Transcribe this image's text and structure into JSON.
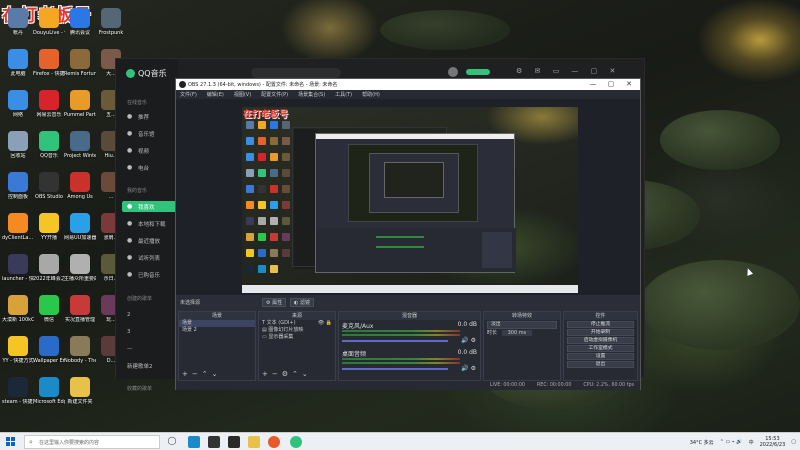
{
  "watermark": "在打老板号",
  "desktop_icons": [
    {
      "label": "帐丹",
      "icon": "notebook-icon",
      "color": "#5a7aa8"
    },
    {
      "label": "DouyuLive - 快捷方式",
      "icon": "douyu-icon",
      "color": "#f5a623"
    },
    {
      "label": "腾讯会议",
      "icon": "meeting-icon",
      "color": "#2b77e5"
    },
    {
      "label": "Frostpunk",
      "icon": "game-icon",
      "color": "#556677"
    },
    {
      "label": "此电脑",
      "icon": "computer-icon",
      "color": "#3a8ee6"
    },
    {
      "label": "Firefox - 快捷方式",
      "icon": "firefox-icon",
      "color": "#e5622b"
    },
    {
      "label": "Remis Fortune ...",
      "icon": "game-icon",
      "color": "#8a6a3a"
    },
    {
      "label": "大...",
      "icon": "game-icon",
      "color": "#7a5a4a"
    },
    {
      "label": "网络",
      "icon": "network-icon",
      "color": "#3a8ee6"
    },
    {
      "label": "网易云音乐",
      "icon": "music-icon",
      "color": "#d8232a"
    },
    {
      "label": "Pummel Party",
      "icon": "game-icon",
      "color": "#e89a2a"
    },
    {
      "label": "五...",
      "icon": "game-icon",
      "color": "#6a5a3a"
    },
    {
      "label": "回收站",
      "icon": "recycle-bin-icon",
      "color": "#8aa0b8"
    },
    {
      "label": "QQ音乐",
      "icon": "qqmusic-icon",
      "color": "#31c27c"
    },
    {
      "label": "Project Winter",
      "icon": "game-icon",
      "color": "#4a6a8a"
    },
    {
      "label": "Hiu...",
      "icon": "game-icon",
      "color": "#5a4a3a"
    },
    {
      "label": "控制面板",
      "icon": "control-panel-icon",
      "color": "#3a7ad6"
    },
    {
      "label": "OBS Studio",
      "icon": "obs-icon",
      "color": "#333333"
    },
    {
      "label": "Among Us",
      "icon": "amongus-icon",
      "color": "#c8322a"
    },
    {
      "label": "...",
      "icon": "game-icon",
      "color": "#6a4a3a"
    },
    {
      "label": "dyClientLa... - 快捷方式",
      "icon": "douyu-icon",
      "color": "#f58a23"
    },
    {
      "label": "YY开播",
      "icon": "yy-icon",
      "color": "#f5c623"
    },
    {
      "label": "网易UU加速器",
      "icon": "uu-icon",
      "color": "#2aa0e8"
    },
    {
      "label": "涨肩...",
      "icon": "game-icon",
      "color": "#7a3a3a"
    },
    {
      "label": "launcher - 快捷方式",
      "icon": "launcher-icon",
      "color": "#3a3a5a"
    },
    {
      "label": "2022年峰会之森的特质",
      "icon": "file-icon",
      "color": "#a8a8a8"
    },
    {
      "label": "主播众所重要的图",
      "icon": "file-icon",
      "color": "#b0b0b0"
    },
    {
      "label": "示日...",
      "icon": "game-icon",
      "color": "#5a5a3a"
    },
    {
      "label": "大漠新 100kChe...",
      "icon": "app-icon",
      "color": "#d8a23a"
    },
    {
      "label": "微信",
      "icon": "wechat-icon",
      "color": "#2ac84a"
    },
    {
      "label": "实况直播管理",
      "icon": "app-icon",
      "color": "#c83a3a"
    },
    {
      "label": "玩...",
      "icon": "game-icon",
      "color": "#6a3a5a"
    },
    {
      "label": "YY - 快捷方式",
      "icon": "yy-icon",
      "color": "#f5c623"
    },
    {
      "label": "Wallpaper Engine - ...",
      "icon": "wallpaper-icon",
      "color": "#2a6ac8"
    },
    {
      "label": "Nobody - The Turna...",
      "icon": "game-icon",
      "color": "#8a7a5a"
    },
    {
      "label": "D...",
      "icon": "game-icon",
      "color": "#5a3a3a"
    },
    {
      "label": "steam - 快捷方式",
      "icon": "steam-icon",
      "color": "#1b2838"
    },
    {
      "label": "Microsoft Edge",
      "icon": "edge-icon",
      "color": "#1a8ac8"
    },
    {
      "label": "新建文件夹",
      "icon": "folder-icon",
      "color": "#e8c14a"
    }
  ],
  "qqmusic": {
    "logo_text": "QQ音乐",
    "sections": {
      "online": "在线音乐",
      "my": "我的音乐",
      "created": "创建的歌单",
      "collected": "收藏的歌单"
    },
    "online_items": [
      {
        "label": "推荐",
        "icon": "home-icon"
      },
      {
        "label": "音乐馆",
        "icon": "music-hall-icon"
      },
      {
        "label": "视频",
        "icon": "video-icon"
      },
      {
        "label": "电台",
        "icon": "radio-icon"
      }
    ],
    "my_items": [
      {
        "label": "我喜欢",
        "icon": "heart-icon"
      },
      {
        "label": "本地和下载",
        "icon": "download-icon"
      },
      {
        "label": "最近播放",
        "icon": "clock-icon"
      },
      {
        "label": "试听列表",
        "icon": "list-icon"
      },
      {
        "label": "已购音乐",
        "icon": "purchased-icon"
      }
    ],
    "created_items": [
      "2",
      "3",
      "—",
      "新建歌单2"
    ]
  },
  "obs": {
    "title": "OBS 27.1.3 (64-bit, windows) - 配置文件: 未命名 - 场景: 未命名",
    "menu": [
      "文件(F)",
      "编辑(E)",
      "视图(V)",
      "配置文件(P)",
      "场景集合(S)",
      "工具(T)",
      "帮助(H)"
    ],
    "bar_label": "未选择源",
    "bar_buttons": [
      "属性",
      "滤镜"
    ],
    "docks": {
      "scenes": {
        "title": "场景",
        "rows": [
          "场景",
          "场景 2"
        ]
      },
      "sources": {
        "title": "来源",
        "rows": [
          "文本 (GDI+)",
          "图像幻灯片放映",
          "显示器采集"
        ]
      },
      "mixer": {
        "title": "混音器",
        "tracks": [
          {
            "name": "麦克风/Aux",
            "db": "0.0 dB"
          },
          {
            "name": "桌面音频",
            "db": "0.0 dB"
          }
        ]
      },
      "transitions": {
        "title": "转场特效",
        "type": "淡出",
        "duration_label": "时长",
        "duration": "300 ms"
      },
      "controls": {
        "title": "控件",
        "buttons": [
          "停止推流",
          "开始录制",
          "启动虚拟摄像机",
          "工作室模式",
          "设置",
          "退出"
        ]
      }
    },
    "status": {
      "live": "LIVE: 00:00:00",
      "rec": "REC: 00:00:00",
      "cpu": "CPU: 2.2%, 60.00 fps"
    }
  },
  "taskbar": {
    "search_placeholder": "在这里输入你要搜索的内容",
    "weather": "34°C 多云",
    "time": "15:53",
    "date": "2022/6/23",
    "ime": "中"
  }
}
